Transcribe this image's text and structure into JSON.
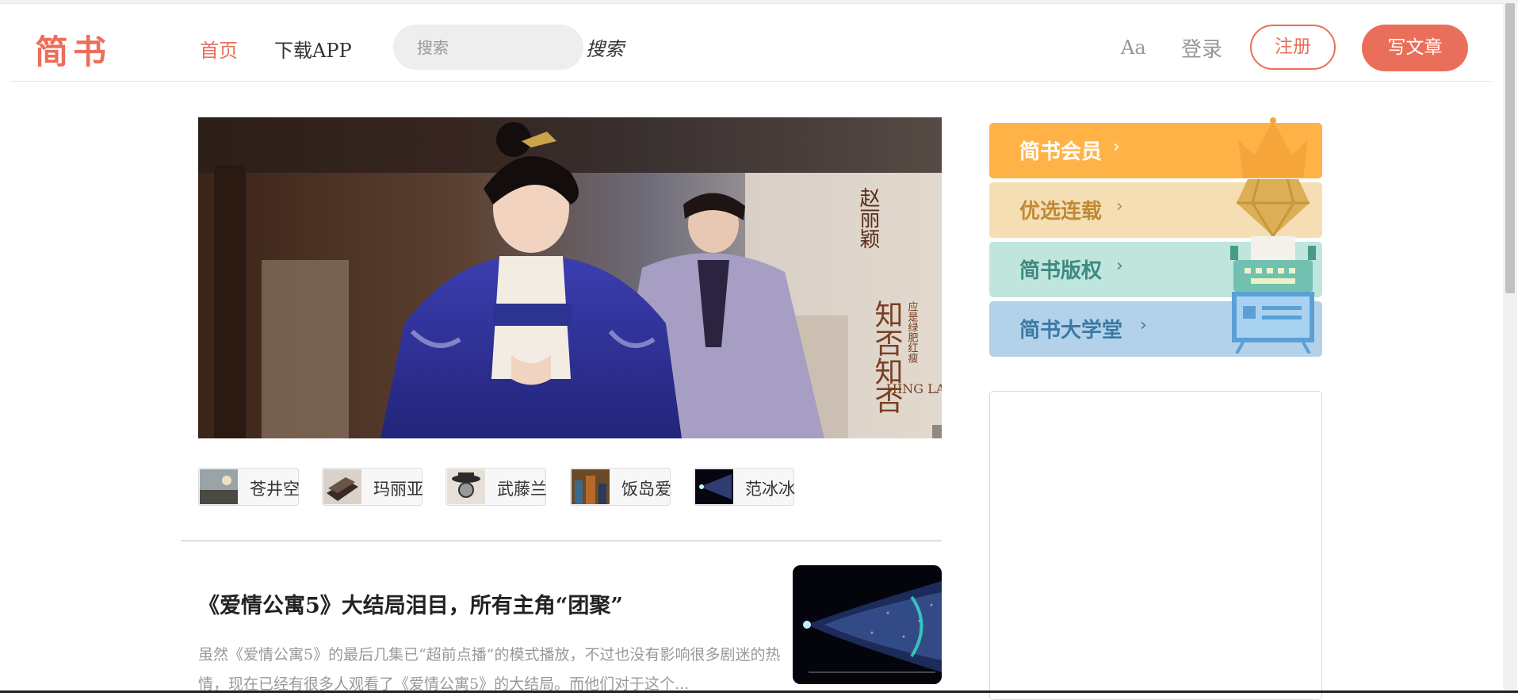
{
  "header": {
    "logo": "简书",
    "nav": {
      "home": "首页",
      "download": "下载APP"
    },
    "search": {
      "placeholder": "搜索",
      "button_label": "搜索"
    },
    "font_toggle": "Aa",
    "login": "登录",
    "register": "注册",
    "write": "写文章"
  },
  "banner": {
    "vertical_text": "赵丽颖",
    "brand_script": "知否知否",
    "sub_script": "应是绿肥红瘦",
    "brand_latin": "HING LAN"
  },
  "tags": [
    {
      "label": "苍井空",
      "icon": "seaside-thumbnail"
    },
    {
      "label": "玛丽亚",
      "icon": "books-thumbnail"
    },
    {
      "label": "武藤兰",
      "icon": "detective-thumbnail"
    },
    {
      "label": "饭岛爱",
      "icon": "city-thumbnail"
    },
    {
      "label": "范冰冰",
      "icon": "universe-thumbnail"
    }
  ],
  "article": {
    "title": "《爱情公寓5》大结局泪目，所有主角“团聚”",
    "abstract": "虽然《爱情公寓5》的最后几集已“超前点播”的模式播放，不过也没有影响很多剧迷的热情，现在已经有很多人观看了《爱情公寓5》的大结局。而他们对于这个...",
    "image": "universe-timeline-image"
  },
  "sidebar": {
    "cards": [
      {
        "label": "简书会员",
        "chevron": "›",
        "bg": "#ffb347",
        "color": "#ffffff",
        "icon": "crown-icon"
      },
      {
        "label": "优选连载",
        "chevron": "›",
        "bg": "#f5deb3",
        "color": "#c08a36",
        "icon": "diamond-icon"
      },
      {
        "label": "简书版权",
        "chevron": "›",
        "bg": "#bfe5dd",
        "color": "#3d8a80",
        "icon": "typewriter-icon"
      },
      {
        "label": "简书大学堂",
        "chevron": "›",
        "bg": "#b3d2ea",
        "color": "#3b79a6",
        "icon": "whiteboard-icon"
      }
    ]
  },
  "colors": {
    "brand": "#ea6f5a",
    "muted": "#969696"
  }
}
